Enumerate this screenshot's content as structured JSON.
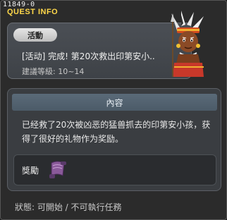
{
  "quest": {
    "id": "11849-0",
    "window_title": "QUEST INFO",
    "category": "活動",
    "name": "[活动] 完成! 第20次救出印第安小..",
    "level": "建議等級: 10~14",
    "content_header": "內容",
    "description": "已经救了20次被凶恶的猛兽抓去的印第安小孩，获得了很好的礼物作为奖励。",
    "reward_label": "獎勵",
    "reward_item_icon": "scroll-icon",
    "status": "狀態: 可開始 / 不可執行任務"
  },
  "colors": {
    "title": "#ffd84a",
    "panel": "#3a3d41",
    "header": "#5a6a78"
  }
}
